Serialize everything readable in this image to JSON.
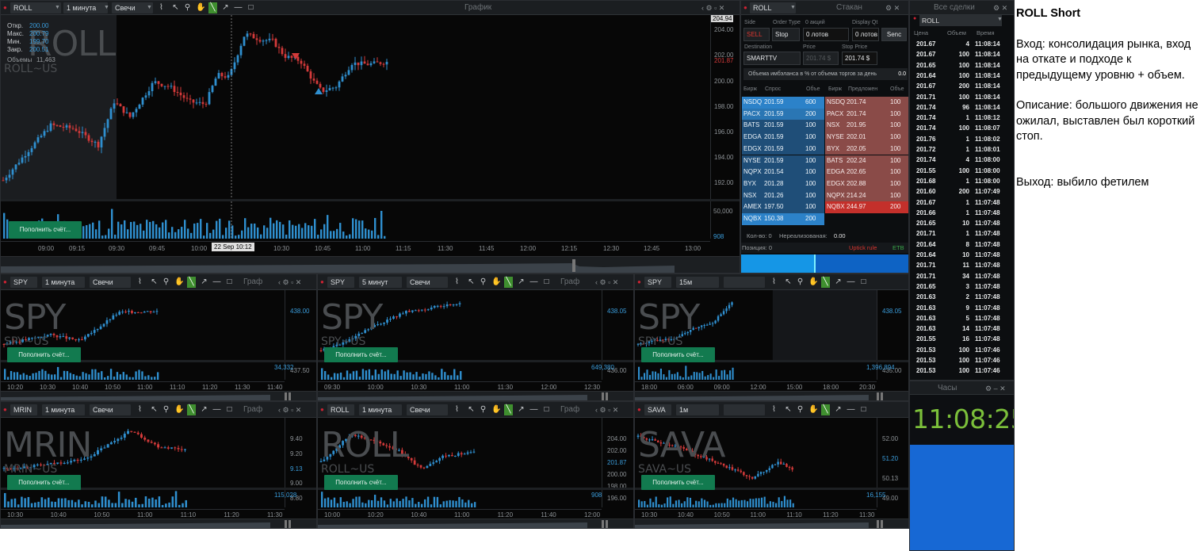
{
  "main_chart": {
    "symbol": "ROLL",
    "interval": "1 минута",
    "chart_type": "Свечи",
    "window_title": "График",
    "ohlc": [
      {
        "label": "Откр.",
        "value": "200.00"
      },
      {
        "label": "Макс.",
        "value": "200.79"
      },
      {
        "label": "Мин.",
        "value": "199.70"
      },
      {
        "label": "Закр.",
        "value": "200.51"
      }
    ],
    "volume_label": "Объемы",
    "volume_value": "11,463",
    "watermark": "ROLL",
    "watermark_sub": "ROLL~US",
    "deposit_button": "Пополнить счёт...",
    "price_ticks": [
      "204.94",
      "204.00",
      "202.00",
      "201.87",
      "200.00",
      "198.00",
      "196.00",
      "194.00",
      "192.00"
    ],
    "volume_ticks": [
      "50,000",
      "908"
    ],
    "time_ticks": [
      "09:00",
      "09:15",
      "09:30",
      "09:45",
      "10:00",
      "22 Sep 10:12",
      "10:30",
      "10:45",
      "11:00",
      "11:15",
      "11:30",
      "11:45",
      "12:00",
      "12:15",
      "12:30",
      "12:45",
      "13:00"
    ],
    "colors": {
      "up": "#2f8fcf",
      "down": "#d43a3a",
      "bg": "#070707"
    }
  },
  "order_entry": {
    "window_title": "Стакан",
    "symbol": "ROLL",
    "side_label": "Side",
    "side_value": "SELL",
    "order_type_label": "Order Type",
    "order_type_value": "Stop",
    "shares_label": "0 акций",
    "qty_value": "0 лотов",
    "display_label": "Display Qt",
    "display_value": "0 лотов",
    "send_button": "Senc",
    "destination_label": "Destination",
    "destination_value": "SMARTTV",
    "price_label": "Price",
    "price_value": "201.74 $",
    "stop_price_label": "Stop Price",
    "stop_price_value": "201.74 $",
    "imbalance_text": "Объема имбэланса в % от объема торгов за день",
    "imbalance_value": "0.0",
    "headers": [
      "Бирж",
      "Спрос",
      "Объе",
      "Бирж",
      "Предложен",
      "Объе"
    ],
    "bids": [
      [
        "NSDQ",
        "201.59",
        "600"
      ],
      [
        "PACX",
        "201.59",
        "200"
      ],
      [
        "BATS",
        "201.59",
        "100"
      ],
      [
        "EDGA",
        "201.59",
        "100"
      ],
      [
        "EDGX",
        "201.59",
        "100"
      ],
      [
        "NYSE",
        "201.59",
        "100"
      ],
      [
        "NQPX",
        "201.54",
        "100"
      ],
      [
        "BYX",
        "201.28",
        "100"
      ],
      [
        "NSX",
        "201.26",
        "100"
      ],
      [
        "AMEX",
        "197.50",
        "100"
      ],
      [
        "NQBX",
        "150.38",
        "200"
      ]
    ],
    "asks": [
      [
        "NSDQ",
        "201.74",
        "100"
      ],
      [
        "PACX",
        "201.74",
        "100"
      ],
      [
        "NSX",
        "201.95",
        "100"
      ],
      [
        "NYSE",
        "202.01",
        "100"
      ],
      [
        "BYX",
        "202.05",
        "100"
      ],
      [
        "BATS",
        "202.24",
        "100"
      ],
      [
        "EDGA",
        "202.65",
        "100"
      ],
      [
        "EDGX",
        "202.88",
        "100"
      ],
      [
        "NQPX",
        "214.24",
        "100"
      ],
      [
        "NQBX",
        "244.97",
        "200"
      ]
    ],
    "qty_label": "Кол-во: 0",
    "unrealized_label": "Нереализованая:",
    "unrealized_value": "0.00",
    "position_label": "Позиция: 0",
    "uptick_label": "Uptick rule",
    "etb_label": "ETB"
  },
  "time_sales": {
    "window_title": "Все сделки",
    "symbol": "ROLL",
    "headers": [
      "Цена",
      "Объем",
      "Время"
    ],
    "rows": [
      [
        "201.67",
        "4",
        "11:08:14"
      ],
      [
        "201.67",
        "100",
        "11:08:14"
      ],
      [
        "201.65",
        "100",
        "11:08:14"
      ],
      [
        "201.64",
        "100",
        "11:08:14"
      ],
      [
        "201.67",
        "200",
        "11:08:14"
      ],
      [
        "201.71",
        "100",
        "11:08:14"
      ],
      [
        "201.74",
        "96",
        "11:08:14"
      ],
      [
        "201.74",
        "1",
        "11:08:12"
      ],
      [
        "201.74",
        "100",
        "11:08:07"
      ],
      [
        "201.76",
        "1",
        "11:08:02"
      ],
      [
        "201.72",
        "1",
        "11:08:01"
      ],
      [
        "201.74",
        "4",
        "11:08:00"
      ],
      [
        "201.55",
        "100",
        "11:08:00"
      ],
      [
        "201.68",
        "1",
        "11:08:00"
      ],
      [
        "201.60",
        "200",
        "11:07:49"
      ],
      [
        "201.67",
        "1",
        "11:07:48"
      ],
      [
        "201.66",
        "1",
        "11:07:48"
      ],
      [
        "201.65",
        "10",
        "11:07:48"
      ],
      [
        "201.71",
        "1",
        "11:07:48"
      ],
      [
        "201.64",
        "8",
        "11:07:48"
      ],
      [
        "201.64",
        "10",
        "11:07:48"
      ],
      [
        "201.71",
        "11",
        "11:07:48"
      ],
      [
        "201.71",
        "34",
        "11:07:48"
      ],
      [
        "201.65",
        "3",
        "11:07:48"
      ],
      [
        "201.63",
        "2",
        "11:07:48"
      ],
      [
        "201.63",
        "9",
        "11:07:48"
      ],
      [
        "201.63",
        "5",
        "11:07:48"
      ],
      [
        "201.63",
        "14",
        "11:07:48"
      ],
      [
        "201.55",
        "16",
        "11:07:48"
      ],
      [
        "201.53",
        "100",
        "11:07:46"
      ],
      [
        "201.53",
        "100",
        "11:07:46"
      ],
      [
        "201.53",
        "100",
        "11:07:46"
      ]
    ]
  },
  "clock": {
    "window_title": "Часы",
    "time": "11:08:25"
  },
  "mini_charts": [
    {
      "symbol": "SPY",
      "interval": "1 минута",
      "type": "Свечи",
      "title": "Граф",
      "wm": "SPY",
      "wm_sub": "SPY~US",
      "button": "Пополнить счёт...",
      "price_ticks": [
        "438.00",
        "437.50"
      ],
      "last": "438.00",
      "vol": "34,332",
      "time_ticks": [
        "10:20",
        "10:30",
        "10:40",
        "10:50",
        "11:00",
        "11:10",
        "11:20",
        "11:30",
        "11:40"
      ]
    },
    {
      "symbol": "SPY",
      "interval": "5 минут",
      "type": "Свечи",
      "title": "Граф",
      "wm": "SPY",
      "wm_sub": "SPY~US",
      "button": "Пополнить счёт...",
      "price_ticks": [
        "438.05",
        "436.00"
      ],
      "last": "438.05",
      "vol": "649,380",
      "time_ticks": [
        "09:30",
        "10:00",
        "10:30",
        "11:00",
        "11:30",
        "12:00",
        "12:30"
      ]
    },
    {
      "symbol": "SPY",
      "interval": "15м",
      "type": "",
      "title": "Граф",
      "wm": "SPY",
      "wm_sub": "SPY~US",
      "button": "Пополнить счёт...",
      "price_ticks": [
        "438.05",
        "435.00"
      ],
      "last": "438.05",
      "vol": "1,396,894",
      "time_ticks": [
        "18:00",
        "06:00",
        "09:00",
        "12:00",
        "15:00",
        "18:00",
        "20:30"
      ]
    },
    {
      "symbol": "MRIN",
      "interval": "1 минута",
      "type": "Свечи",
      "title": "Граф",
      "wm": "MRIN",
      "wm_sub": "MRIN~US",
      "button": "Пополнить счёт...",
      "price_ticks": [
        "9.40",
        "9.20",
        "9.13",
        "9.00",
        "8.80"
      ],
      "last": "9.13",
      "vol": "115,028",
      "time_ticks": [
        "10:30",
        "10:40",
        "10:50",
        "11:00",
        "11:10",
        "11:20",
        "11:30"
      ]
    },
    {
      "symbol": "ROLL",
      "interval": "1 минута",
      "type": "Свечи",
      "title": "Граф",
      "wm": "ROLL",
      "wm_sub": "ROLL~US",
      "button": "Пополнить счёт...",
      "price_ticks": [
        "204.00",
        "202.00",
        "201.87",
        "200.00",
        "198.00",
        "196.00"
      ],
      "last": "201.87",
      "vol": "908",
      "time_ticks": [
        "10:00",
        "10:20",
        "10:40",
        "11:00",
        "11:20",
        "11:40",
        "12:00"
      ]
    },
    {
      "symbol": "SAVA",
      "interval": "1м",
      "type": "",
      "title": "Граф",
      "wm": "SAVA",
      "wm_sub": "SAVA~US",
      "button": "Пополнить счёт...",
      "price_ticks": [
        "52.00",
        "51.20",
        "50.13",
        "49.00"
      ],
      "last": "51.20",
      "vol": "16,155",
      "time_ticks": [
        "10:30",
        "10:40",
        "10:50",
        "11:00",
        "11:10",
        "11:20",
        "11:30"
      ]
    }
  ],
  "notes": {
    "title": "ROLL Short",
    "entry": "Вход: консолидация рынка, вход на откате и подходе к предыдущему уровню + объем.",
    "description": "Описание: большого движения не ожилал, выставлен был короткий стоп.",
    "exit": "Выход: выбило фетилем"
  }
}
